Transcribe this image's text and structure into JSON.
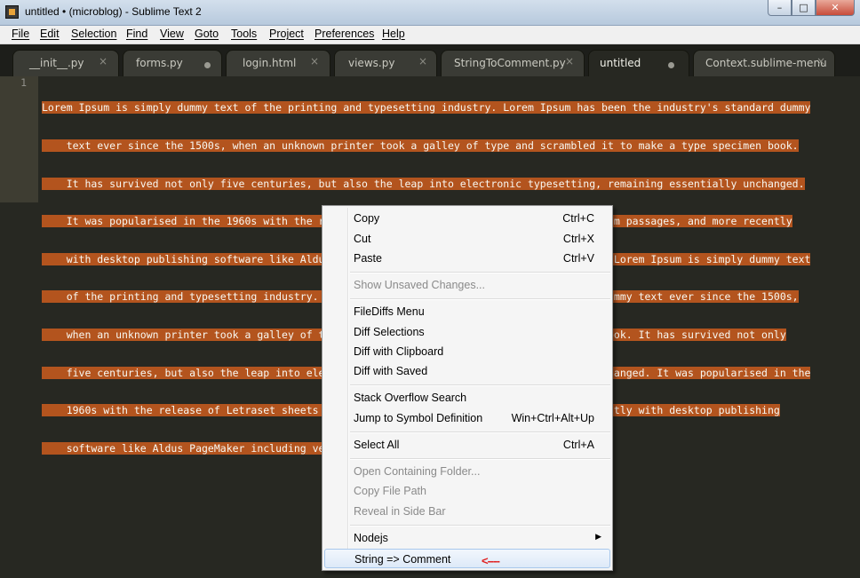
{
  "window": {
    "title": "untitled • (microblog) - Sublime Text 2",
    "buttons": {
      "minimize": "–",
      "maximize": "□",
      "close": "✕"
    }
  },
  "menubar": [
    "File",
    "Edit",
    "Selection",
    "Find",
    "View",
    "Goto",
    "Tools",
    "Project",
    "Preferences",
    "Help"
  ],
  "tabs": [
    {
      "label": "__init__.py",
      "marker": "×"
    },
    {
      "label": "forms.py",
      "marker": "●"
    },
    {
      "label": "login.html",
      "marker": "×"
    },
    {
      "label": "views.py",
      "marker": "×"
    },
    {
      "label": "StringToComment.py",
      "marker": "×"
    },
    {
      "label": "untitled",
      "marker": "●"
    },
    {
      "label": "Context.sublime-menu",
      "marker": "×"
    }
  ],
  "editor": {
    "line_number": "1",
    "lines": [
      "Lorem Ipsum is simply dummy text of the printing and typesetting industry. Lorem Ipsum has been the industry's standard dummy",
      "    text ever since the 1500s, when an unknown printer took a galley of type and scrambled it to make a type specimen book.",
      "    It has survived not only five centuries, but also the leap into electronic typesetting, remaining essentially unchanged.",
      "    It was popularised in the 1960s with the release of Letraset sheets containing Lorem Ipsum passages, and more recently",
      "    with desktop publishing software like Aldus PageMaker including versions of Lorem Ipsum. Lorem Ipsum is simply dummy text",
      "    of the printing and typesetting industry. Lorem Ipsum has been the industry's standard dummy text ever since the 1500s,",
      "    when an unknown printer took a galley of type and scrambled it to make a type specimen book. It has survived not only",
      "    five centuries, but also the leap into electronic typesetting, remaining essentially unchanged. It was popularised in the",
      "    1960s with the release of Letraset sheets containing Lorem Ipsum passages, and more recently with desktop publishing",
      "    software like Aldus PageMaker including versions of Lorem Ipsum."
    ],
    "selection_color": "#b3541e"
  },
  "context_menu": {
    "items": [
      {
        "label": "Copy",
        "shortcut": "Ctrl+C",
        "disabled": false
      },
      {
        "label": "Cut",
        "shortcut": "Ctrl+X",
        "disabled": false
      },
      {
        "label": "Paste",
        "shortcut": "Ctrl+V",
        "disabled": false
      },
      {
        "label": "Show Unsaved Changes...",
        "shortcut": "",
        "disabled": true
      },
      {
        "label": "FileDiffs Menu",
        "shortcut": "",
        "disabled": false
      },
      {
        "label": "Diff Selections",
        "shortcut": "",
        "disabled": false
      },
      {
        "label": "Diff with Clipboard",
        "shortcut": "",
        "disabled": false
      },
      {
        "label": "Diff with Saved",
        "shortcut": "",
        "disabled": false
      },
      {
        "label": "Stack Overflow Search",
        "shortcut": "",
        "disabled": false
      },
      {
        "label": "Jump to Symbol Definition",
        "shortcut": "Win+Ctrl+Alt+Up",
        "disabled": false
      },
      {
        "label": "Select All",
        "shortcut": "Ctrl+A",
        "disabled": false
      },
      {
        "label": "Open Containing Folder...",
        "shortcut": "",
        "disabled": true
      },
      {
        "label": "Copy File Path",
        "shortcut": "",
        "disabled": true
      },
      {
        "label": "Reveal in Side Bar",
        "shortcut": "",
        "disabled": true
      },
      {
        "label": "Nodejs",
        "shortcut": "",
        "disabled": false,
        "submenu": "▶"
      },
      {
        "label": "String => Comment",
        "shortcut": "",
        "disabled": false,
        "hovered": true,
        "annotation": "<----"
      }
    ]
  }
}
